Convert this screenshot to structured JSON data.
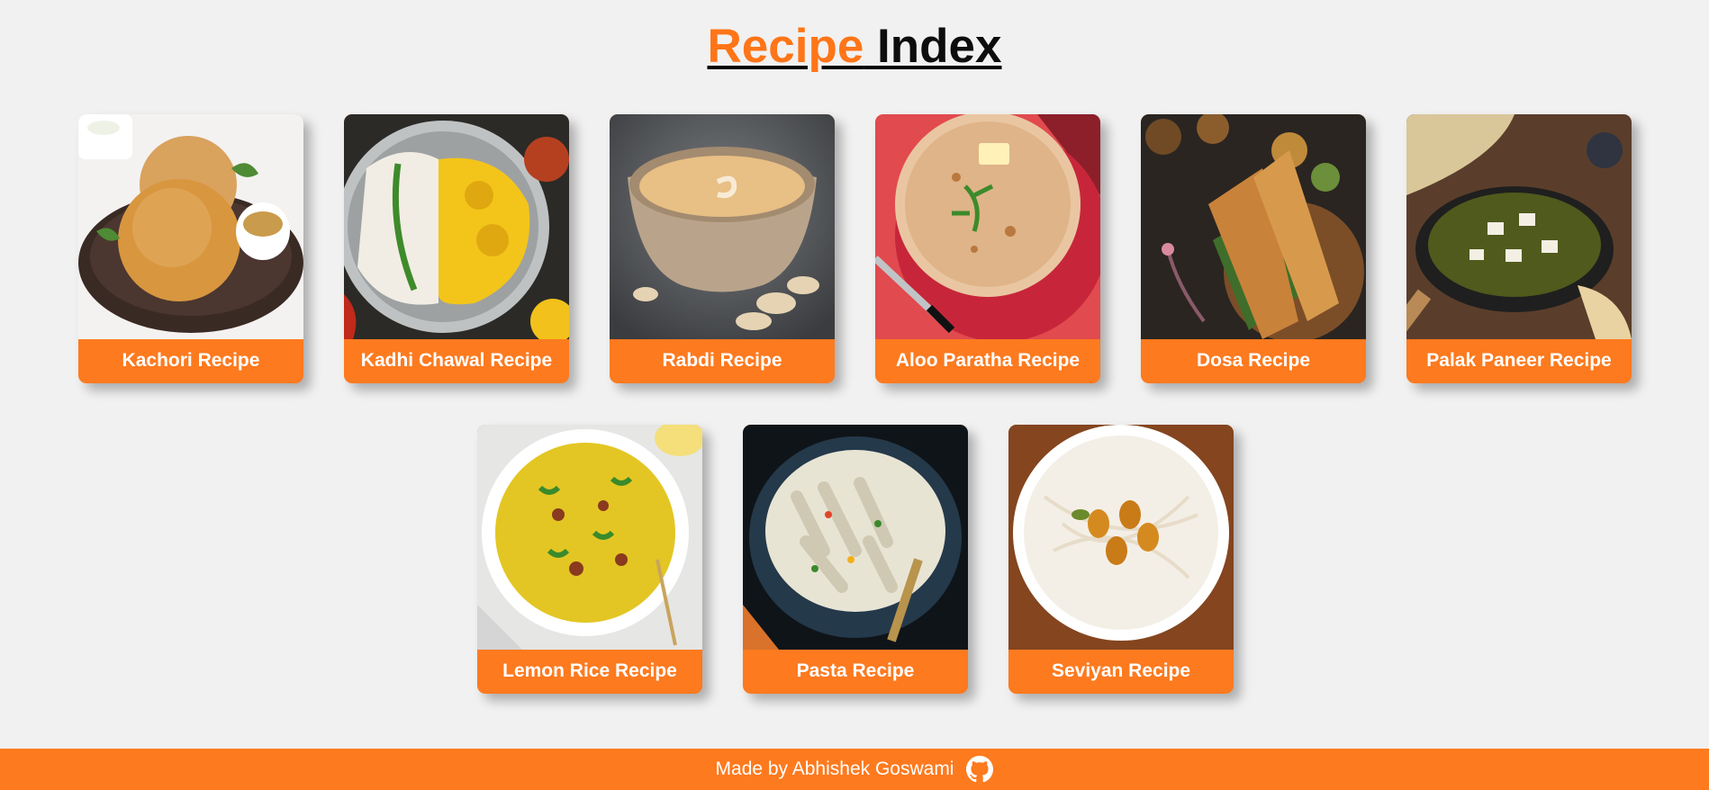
{
  "header": {
    "title_accent": "Recipe",
    "title_main": "Index"
  },
  "recipes": [
    {
      "label": "Kachori Recipe",
      "image": "kachori-photo"
    },
    {
      "label": "Kadhi Chawal Recipe",
      "image": "kadhi-chawal-photo"
    },
    {
      "label": "Rabdi Recipe",
      "image": "rabdi-photo"
    },
    {
      "label": "Aloo Paratha Recipe",
      "image": "aloo-paratha-photo"
    },
    {
      "label": "Dosa Recipe",
      "image": "dosa-photo"
    },
    {
      "label": "Palak Paneer Recipe",
      "image": "palak-paneer-photo"
    },
    {
      "label": "Lemon Rice Recipe",
      "image": "lemon-rice-photo"
    },
    {
      "label": "Pasta Recipe",
      "image": "pasta-photo"
    },
    {
      "label": "Seviyan Recipe",
      "image": "seviyan-photo"
    }
  ],
  "footer": {
    "text": "Made by Abhishek Goswami",
    "icon": "github-icon"
  },
  "colors": {
    "accent": "#fd7a1f",
    "background": "#f1f1f1",
    "title_dark": "#0d0d0d"
  }
}
